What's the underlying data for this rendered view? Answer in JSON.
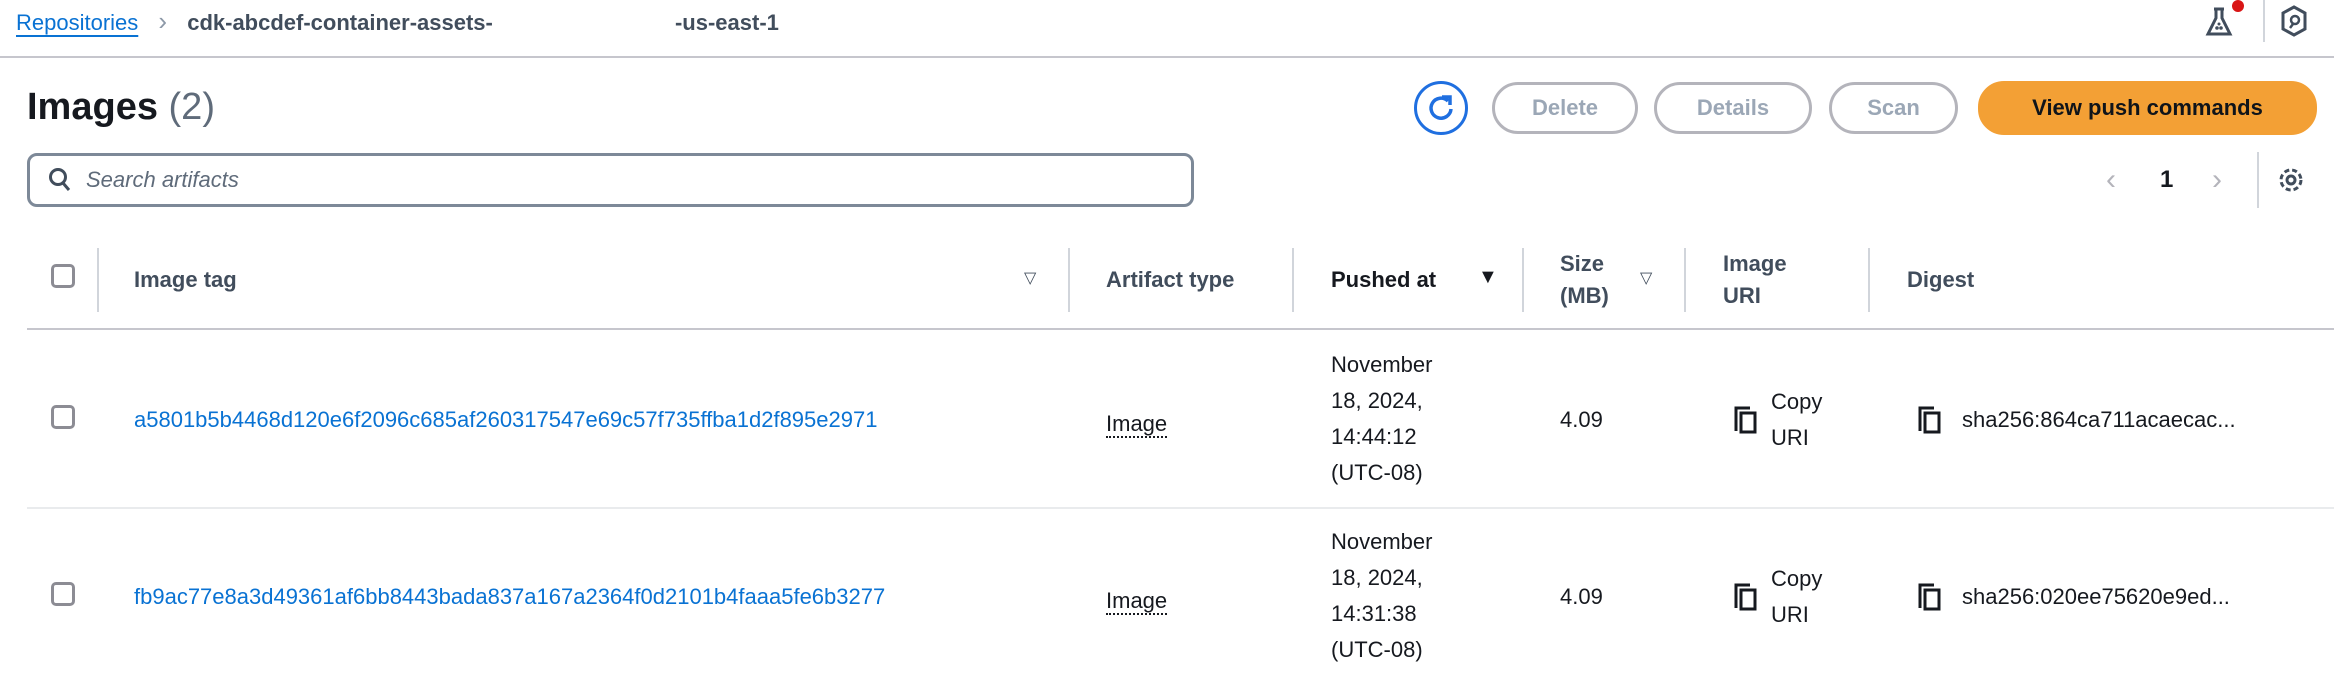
{
  "breadcrumb": {
    "root": "Repositories",
    "current_prefix": "cdk-abcdef-container-assets-",
    "current_suffix": "-us-east-1"
  },
  "header_icons": [
    "flask-icon",
    "notification-dot",
    "hexagon-icon"
  ],
  "colors": {
    "accent": "#0972d3",
    "primary_button": "#f3a035",
    "notification": "#d91515"
  },
  "title": {
    "text": "Images",
    "count": "(2)"
  },
  "actions": {
    "delete": "Delete",
    "details": "Details",
    "scan": "Scan",
    "view_push": "View push commands"
  },
  "search": {
    "placeholder": "Search artifacts",
    "value": ""
  },
  "pagination": {
    "page": "1"
  },
  "table": {
    "columns": {
      "image_tag": "Image tag",
      "artifact_type": "Artifact type",
      "pushed_at": "Pushed at",
      "size_l1": "Size",
      "size_l2": "(MB)",
      "uri_l1": "Image",
      "uri_l2": "URI",
      "digest": "Digest"
    },
    "rows": [
      {
        "tag": "a5801b5b4468d120e6f2096c685af260317547e69c57f735ffba1d2f895e2971",
        "type": "Image",
        "pushed": [
          "November",
          "18, 2024,",
          "14:44:12",
          "(UTC-08)"
        ],
        "size": "4.09",
        "copy_l1": "Copy",
        "copy_l2": "URI",
        "digest": "sha256:864ca711acaecac..."
      },
      {
        "tag": "fb9ac77e8a3d49361af6bb8443bada837a167a2364f0d2101b4faaa5fe6b3277",
        "type": "Image",
        "pushed": [
          "November",
          "18, 2024,",
          "14:31:38",
          "(UTC-08)"
        ],
        "size": "4.09",
        "copy_l1": "Copy",
        "copy_l2": "URI",
        "digest": "sha256:020ee75620e9ed..."
      }
    ]
  }
}
